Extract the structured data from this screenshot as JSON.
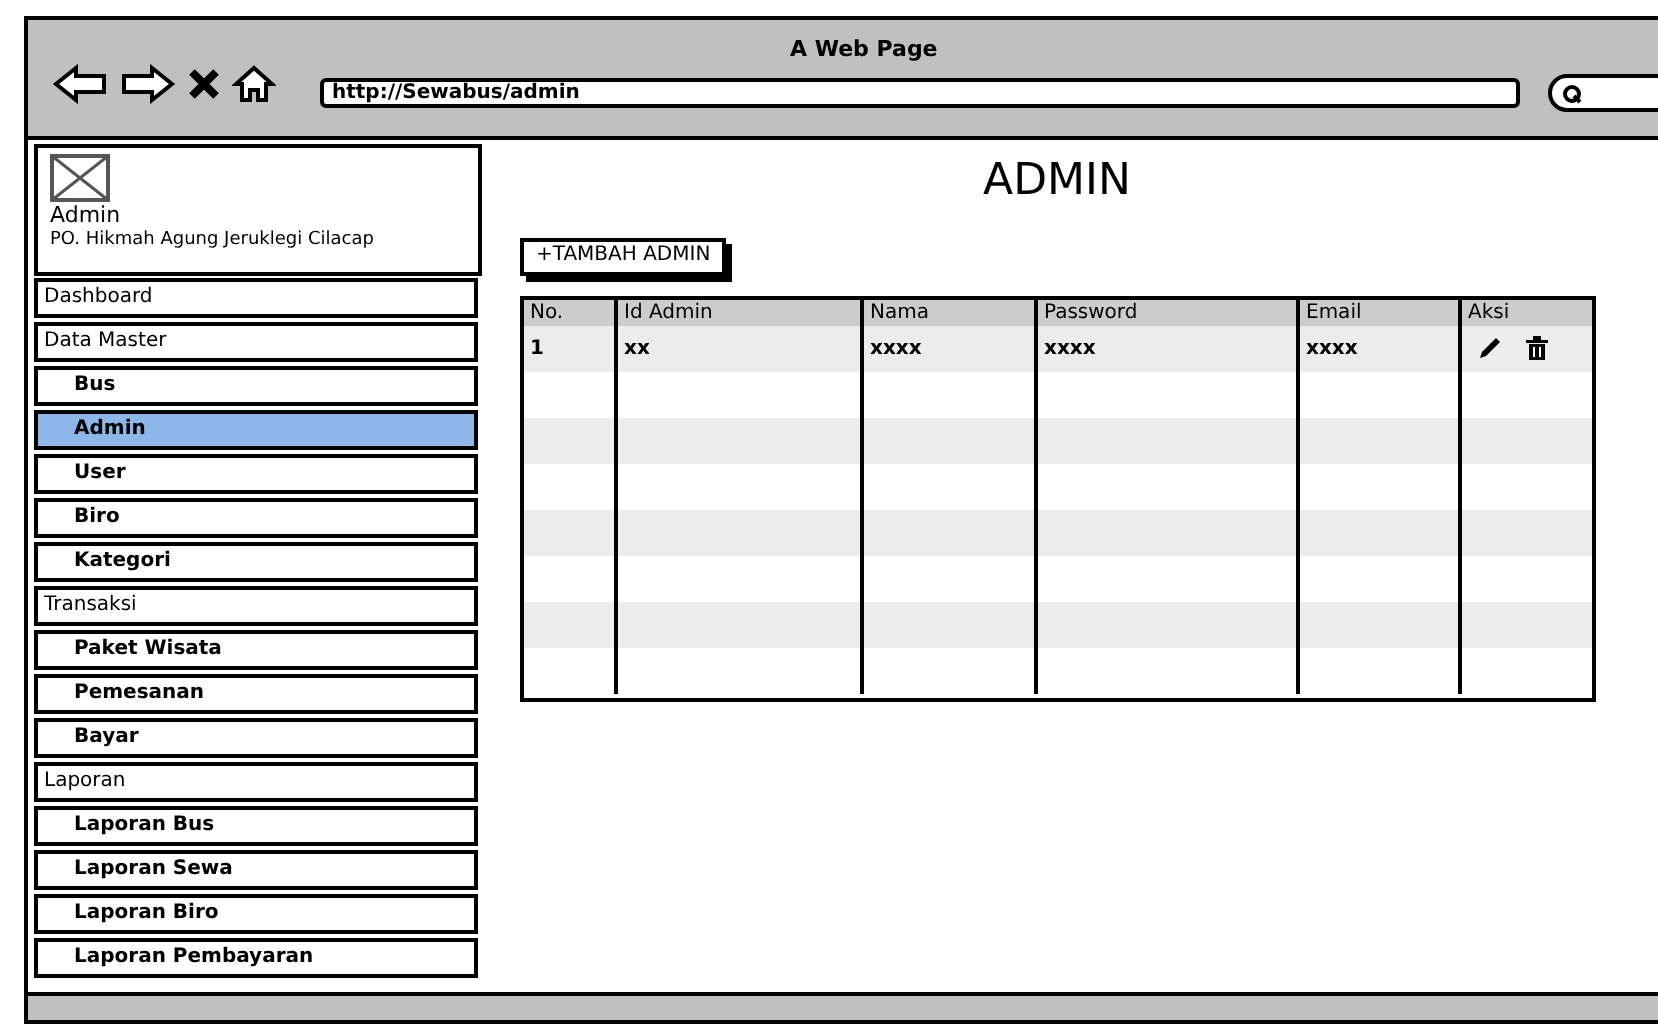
{
  "window": {
    "title": "A Web Page"
  },
  "browser": {
    "url": "http://Sewabus/admin"
  },
  "profile": {
    "name": "Admin",
    "organization": "PO. Hikmah Agung Jeruklegi Cilacap"
  },
  "sidebar": {
    "items": [
      {
        "label": "Dashboard",
        "selected": false
      },
      {
        "label": "Data Master",
        "selected": false,
        "children": [
          {
            "label": "Bus",
            "selected": false
          },
          {
            "label": "Admin",
            "selected": true
          },
          {
            "label": "User",
            "selected": false
          },
          {
            "label": "Biro",
            "selected": false
          },
          {
            "label": "Kategori",
            "selected": false
          }
        ]
      },
      {
        "label": "Transaksi",
        "selected": false,
        "children": [
          {
            "label": "Paket Wisata",
            "selected": false
          },
          {
            "label": "Pemesanan",
            "selected": false
          },
          {
            "label": "Bayar",
            "selected": false
          }
        ]
      },
      {
        "label": "Laporan",
        "selected": false,
        "children": [
          {
            "label": "Laporan Bus",
            "selected": false
          },
          {
            "label": "Laporan Sewa",
            "selected": false
          },
          {
            "label": "Laporan Biro",
            "selected": false
          },
          {
            "label": "Laporan Pembayaran",
            "selected": false
          }
        ]
      }
    ]
  },
  "page": {
    "heading": "ADMIN",
    "add_button": "+TAMBAH ADMIN"
  },
  "table": {
    "columns": [
      "No.",
      "Id Admin",
      "Nama",
      "Password",
      "Email",
      "Aksi"
    ],
    "rows": [
      {
        "cells": [
          "1",
          "xx",
          "xxxx",
          "xxxx",
          "xxxx"
        ],
        "actions": [
          {
            "kind": "edit"
          },
          {
            "kind": "delete"
          }
        ]
      }
    ]
  }
}
